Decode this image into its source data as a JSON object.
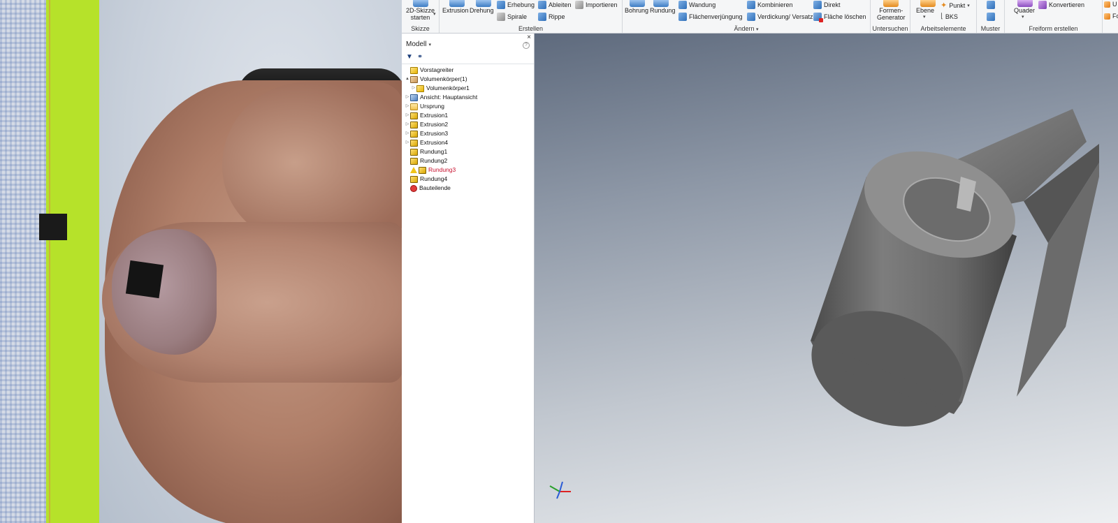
{
  "ribbon": {
    "skizze": {
      "start_label_1": "2D-Skizze",
      "start_label_2": "starten",
      "group_label": "Skizze"
    },
    "erstellen": {
      "extrusion": "Extrusion",
      "drehung": "Drehung",
      "erhebung": "Erhebung",
      "spirale": "Spirale",
      "ableiten": "Ableiten",
      "rippe": "Rippe",
      "importieren": "Importieren",
      "group_label": "Erstellen"
    },
    "aendern": {
      "bohrung": "Bohrung",
      "rundung": "Rundung",
      "wandung": "Wandung",
      "flaechenverjuengung": "Flächenverjüngung",
      "kombinieren": "Kombinieren",
      "verdickung": "Verdickung/ Versatz",
      "direkt": "Direkt",
      "flaeche_loeschen": "Fläche löschen",
      "group_label": "Ändern"
    },
    "untersuchen": {
      "formen_1": "Formen-",
      "formen_2": "Generator",
      "group_label": "Untersuchen"
    },
    "arbeitselemente": {
      "ebene": "Ebene",
      "punkt": "Punkt",
      "bks": "BKS",
      "group_label": "Arbeitselemente"
    },
    "muster": {
      "group_label": "Muster"
    },
    "freiform": {
      "quader": "Quader",
      "konvertieren": "Konvertieren",
      "cut_1": "U",
      "cut_2": "Fo",
      "group_label": "Freiform erstellen"
    }
  },
  "browser": {
    "title": "Modell",
    "close_glyph": "×",
    "help_glyph": "?",
    "tree": [
      {
        "label": "Vorstagreiter",
        "icon": "part",
        "level": 0,
        "expander": ""
      },
      {
        "label": "Volumenkörper(1)",
        "icon": "solids",
        "level": 0,
        "expander": "▲"
      },
      {
        "label": "Volumenkörper1",
        "icon": "part",
        "level": 1,
        "expander": "▷"
      },
      {
        "label": "Ansicht: Hauptansicht",
        "icon": "view",
        "level": 0,
        "expander": "▷"
      },
      {
        "label": "Ursprung",
        "icon": "folder",
        "level": 0,
        "expander": "▷"
      },
      {
        "label": "Extrusion1",
        "icon": "feature",
        "level": 0,
        "expander": "▷"
      },
      {
        "label": "Extrusion2",
        "icon": "feature",
        "level": 0,
        "expander": "▷"
      },
      {
        "label": "Extrusion3",
        "icon": "feature",
        "level": 0,
        "expander": "▷"
      },
      {
        "label": "Extrusion4",
        "icon": "feature",
        "level": 0,
        "expander": "▷"
      },
      {
        "label": "Rundung1",
        "icon": "feature",
        "level": 0,
        "expander": ""
      },
      {
        "label": "Rundung2",
        "icon": "feature",
        "level": 0,
        "expander": ""
      },
      {
        "label": "Rundung3",
        "icon": "feature",
        "level": 0,
        "expander": "",
        "warning": true
      },
      {
        "label": "Rundung4",
        "icon": "feature",
        "level": 0,
        "expander": ""
      },
      {
        "label": "Bauteilende",
        "icon": "end",
        "level": 0,
        "expander": ""
      }
    ]
  },
  "colors": {
    "error_text": "#c8102e",
    "warning": "#f0c419",
    "model_gray": "#6f6f6f"
  }
}
